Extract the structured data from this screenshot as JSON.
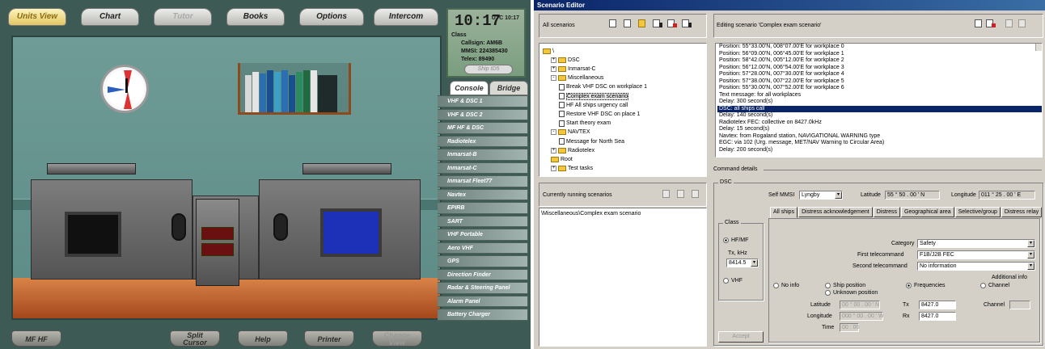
{
  "sim": {
    "top_tabs": [
      "Units View",
      "Chart",
      "Tutor",
      "Books",
      "Options",
      "Intercom"
    ],
    "status": {
      "time": "10:17",
      "utc": "UTC 10:17",
      "class_label": "Class",
      "callsign": "Callsign: AM6B",
      "mmsi": "MMSI: 224385430",
      "telex": "Telex: 89490"
    },
    "ship_id_label": "Ship ID5",
    "console_tab": "Console",
    "bridge_tab": "Bridge",
    "menu": [
      "VHF & DSC 1",
      "VHF & DSC 2",
      "MF HF & DSC",
      "Radiotelex",
      "Inmarsat-B",
      "Inmarsat-C",
      "Inmarsat Fleet77",
      "Navtex",
      "EPIRB",
      "SART",
      "VHF Portable",
      "Aero VHF",
      "GPS",
      "Direction Finder",
      "Radar & Steering Panel",
      "Alarm Panel",
      "Battery Charger"
    ],
    "bottom": [
      "MF HF",
      "Split Cursor",
      "Help",
      "Printer",
      "Change View"
    ]
  },
  "editor": {
    "title": "Scenario Editor",
    "all_scenarios_label": "All scenarios",
    "editing_label": "Editing scenario 'Complex exam scenario'",
    "tree": [
      {
        "label": "\\",
        "type": "folder",
        "indent": 0
      },
      {
        "label": "DSC",
        "type": "folder",
        "indent": 1,
        "pm": "+"
      },
      {
        "label": "Inmarsat-C",
        "type": "folder",
        "indent": 1,
        "pm": "+"
      },
      {
        "label": "Miscellaneous",
        "type": "folder",
        "indent": 1,
        "pm": "-"
      },
      {
        "label": "Break VHF DSC on workplace 1",
        "type": "doc",
        "indent": 2
      },
      {
        "label": "Complex exam scenario",
        "type": "doc",
        "indent": 2,
        "selected": true
      },
      {
        "label": "HF All ships urgency call",
        "type": "doc",
        "indent": 2
      },
      {
        "label": "Restore VHF DSC on place 1",
        "type": "doc",
        "indent": 2
      },
      {
        "label": "Start theory exam",
        "type": "doc",
        "indent": 2
      },
      {
        "label": "NAVTEX",
        "type": "folder",
        "indent": 1,
        "pm": "-"
      },
      {
        "label": "Message for North Sea",
        "type": "doc",
        "indent": 2
      },
      {
        "label": "Radiotelex",
        "type": "folder",
        "indent": 1,
        "pm": "+"
      },
      {
        "label": "Root",
        "type": "folder",
        "indent": 1
      },
      {
        "label": "Test tasks",
        "type": "folder",
        "indent": 1,
        "pm": "+"
      }
    ],
    "running_label": "Currently running scenarios",
    "running_items": [
      "\\Miscellaneous\\Complex exam scenario"
    ],
    "log": [
      "Position: 55°33.00'N, 008°07.00'E for workplace 0",
      "Position: 56°09.00'N, 006°45.00'E for workplace 1",
      "Position: 58°42.00'N, 005°12.00'E for workplace 2",
      "Position: 56°12.00'N, 006°54.00'E for workplace 3",
      "Position: 57°28.00'N, 007°30.00'E for workplace 4",
      "Position: 57°38.00'N, 007°22.00'E for workplace 5",
      "Position: 55°30.00'N, 007°52.00'E for workplace 6",
      "Text message: for all workplaces",
      "Delay: 300 second(s)",
      "DSC: all ships call",
      "Delay: 140 second(s)",
      "Radiotelex FEC: collective on 8427.0kHz",
      "Delay: 15 second(s)",
      "Navtex: from Rogaland station, NAVIGATIONAL WARNING type",
      "EGC: via 102 (Urg. message, MET/NAV Warning to Circular Area)",
      "Delay: 200 second(s)"
    ],
    "log_selected": 9,
    "command_details": "Command details",
    "dsc_label": "DSC",
    "self_mmsi_label": "Self MMSI",
    "self_mmsi_value": "Lyngby",
    "latitude_label": "Latitude",
    "latitude_value": "55 ° 50 . 00 ' N",
    "longitude_label": "Longitude",
    "longitude_value": "011 ° 25 . 00 ' E",
    "tabs": [
      "All ships",
      "Distress acknowledgement",
      "Distress",
      "Geographical area",
      "Selective/group",
      "Distress relay"
    ],
    "class_label": "Class",
    "hfmf_label": "HF/MF",
    "tx_khz_label": "Tx, kHz",
    "tx_khz_value": "8414.5",
    "vhf_label": "VHF",
    "category_label": "Category",
    "category_value": "Safety",
    "first_tc_label": "First telecommand",
    "first_tc_value": "F1B/J2B FEC",
    "second_tc_label": "Second telecommand",
    "second_tc_value": "No information",
    "additional_info": "Additional info",
    "no_info": "No info",
    "ship_position": "Ship position",
    "unknown_position": "Unknown position",
    "frequencies": "Frequencies",
    "channel": "Channel",
    "pos_lat_label": "Latitude",
    "pos_lat_value": "00 ° 00 . 00 ' N",
    "pos_lon_label": "Longitude",
    "pos_lon_value": "000 ° 00 . 00 ' W",
    "time_label": "Time",
    "time_value": "00 : 00",
    "tx_label": "Tx",
    "tx_value": "8427.0",
    "rx_label": "Rx",
    "rx_value": "8427.0",
    "channel_label": "Channel",
    "accept_label": "Accept"
  }
}
